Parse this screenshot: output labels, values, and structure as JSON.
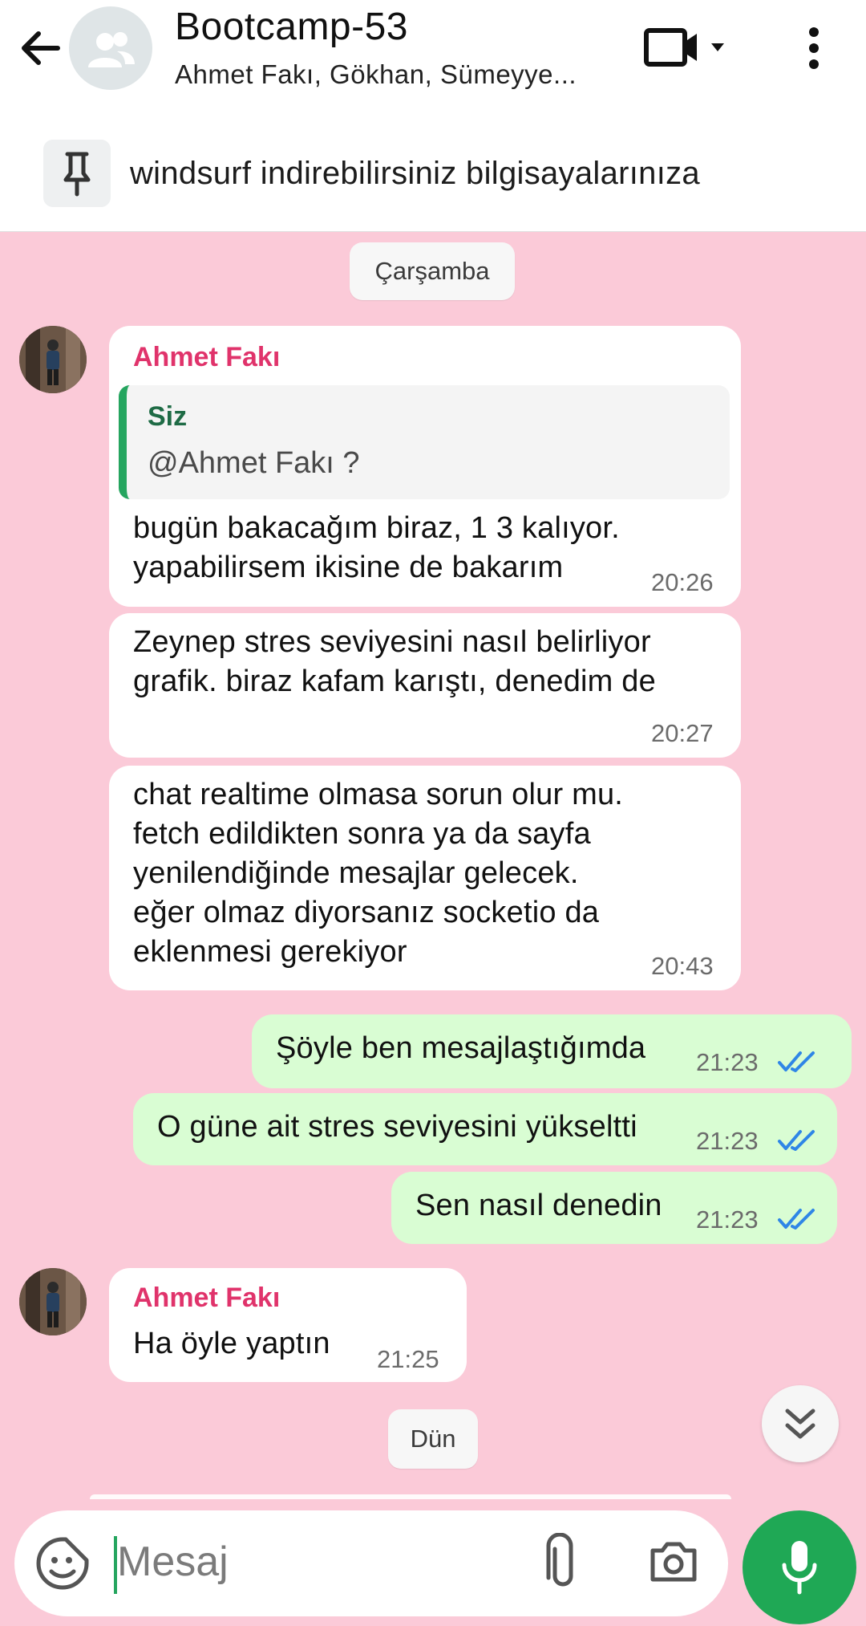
{
  "header": {
    "title": "Bootcamp-53",
    "subtitle": "Ahmet Fakı, Gökhan, Sümeyye...",
    "icons": [
      "back-arrow-icon",
      "group-avatar-icon",
      "video-call-icon",
      "dropdown-icon",
      "more-vert-icon"
    ]
  },
  "pinned": {
    "text": "windsurf indirebilirsiniz bilgisayalarınıza",
    "icon": "pin-icon"
  },
  "dates": {
    "first": "Çarşamba",
    "second": "Dün"
  },
  "messages": [
    {
      "sender": "Ahmet Fakı",
      "quote": {
        "name": "Siz",
        "text": "@Ahmet Fakı ?"
      },
      "text": "bugün bakacağım biraz, 1 3 kalıyor.\nyapabilirsem ikisine de bakarım",
      "time": "20:26"
    },
    {
      "text": "Zeynep stres seviyesini nasıl belirliyor\ngrafik. biraz kafam karıştı, denedim de",
      "time": "20:27"
    },
    {
      "text": "chat realtime olmasa sorun olur mu.\nfetch edildikten sonra ya da sayfa\nyenilendiğinde mesajlar gelecek.\neğer olmaz diyorsanız socketio da\neklenmesi gerekiyor",
      "time": "20:43"
    },
    {
      "text": "Şöyle ben mesajlaştığımda",
      "time": "21:23",
      "outgoing": true
    },
    {
      "text": "O güne ait stres seviyesini yükseltti",
      "time": "21:23",
      "outgoing": true
    },
    {
      "text": "Sen nasıl denedin",
      "time": "21:23",
      "outgoing": true
    },
    {
      "sender": "Ahmet Fakı",
      "text": "Ha öyle yaptın",
      "time": "21:25"
    }
  ],
  "input": {
    "placeholder": "Mesaj"
  },
  "colors": {
    "background": "#fbcad8",
    "outgoing_bubble": "#d9fdd3",
    "sender_name": "#e0336b",
    "accent_green": "#1fa855",
    "read_ticks": "#2f86e6"
  }
}
